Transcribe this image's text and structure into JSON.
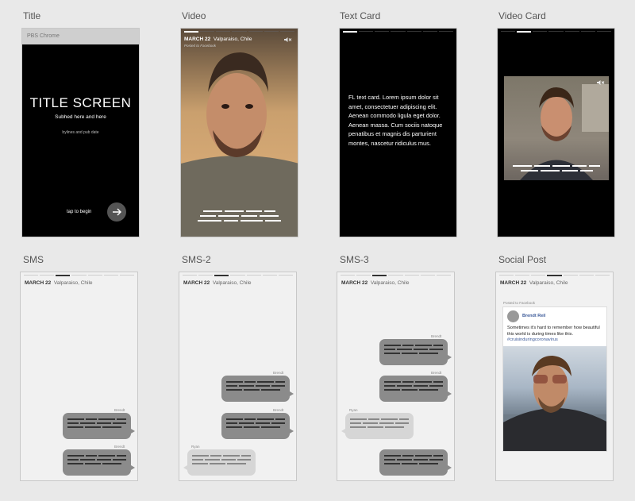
{
  "artboards": [
    {
      "id": "title",
      "label": "Title"
    },
    {
      "id": "video",
      "label": "Video"
    },
    {
      "id": "text_card",
      "label": "Text Card"
    },
    {
      "id": "video_card",
      "label": "Video Card"
    },
    {
      "id": "sms",
      "label": "SMS"
    },
    {
      "id": "sms2",
      "label": "SMS-2"
    },
    {
      "id": "sms3",
      "label": "SMS-3"
    },
    {
      "id": "social",
      "label": "Social Post"
    }
  ],
  "title_screen": {
    "chrome_label": "PBS Chrome",
    "heading": "TITLE SCREEN",
    "subhed": "Subhed here and here",
    "byline": "bylines and pub date",
    "tap_label": "tap to begin",
    "next_icon": "arrow-right-icon"
  },
  "dateline": {
    "date": "MARCH 22",
    "location": "Valparaiso, Chile"
  },
  "video": {
    "posted": "Posted to Facebook",
    "mute_icon": "mute-icon"
  },
  "text_card": {
    "body": "FL text card. Lorem ipsum dolor sit amet, consectetuer adipiscing elit. Aenean commodo ligula eget dolor. Aenean massa. Cum sociis natoque penatibus et magnis dis parturient montes, nascetur ridiculus mus."
  },
  "sms": {
    "sender_brendt": "Brendt",
    "sender_ryan": "Ryan"
  },
  "social": {
    "posted": "Posted to Facebook",
    "name": "Brendt Reil",
    "text": "Sometimes it's hard to remember how beautiful this world is during times like this.",
    "hashtag": "#cruisinduringcoronavirus"
  },
  "colors": {
    "canvas": "#e9e9e9",
    "dark": "#000000",
    "light": "#f1f1f1",
    "bubble_out": "#8b8b8b",
    "bubble_in": "#d6d6d6",
    "link": "#3b5998"
  }
}
